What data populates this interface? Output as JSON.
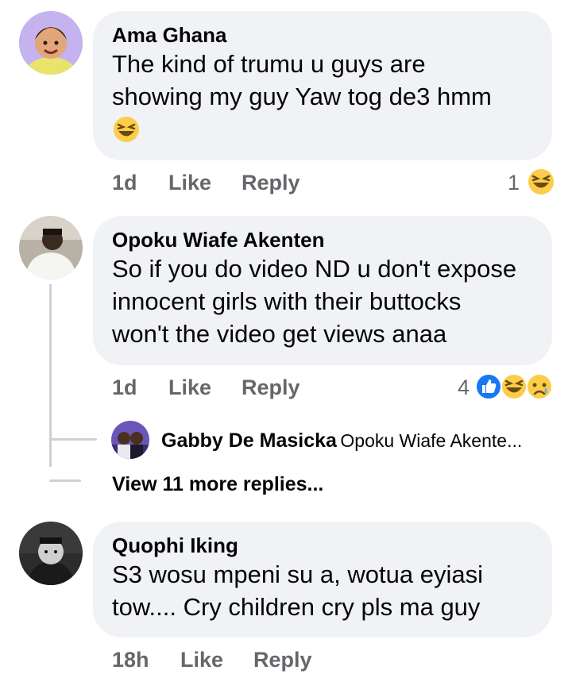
{
  "comments": [
    {
      "author": "Ama Ghana",
      "lines": [
        "The kind of trumu u guys are",
        "showing my guy Yaw tog de3 hmm"
      ],
      "time": "1d",
      "like_label": "Like",
      "reply_label": "Reply",
      "reaction_count": "1",
      "reactions": [
        "laughing-emoji"
      ]
    },
    {
      "author": "Opoku Wiafe Akenten",
      "lines": [
        "So if you do video ND u don't expose",
        "innocent girls with their buttocks",
        "won't the video get views anaa"
      ],
      "time": "1d",
      "like_label": "Like",
      "reply_label": "Reply",
      "reaction_count": "4",
      "reactions": [
        "like-emoji",
        "laughing-emoji",
        "sad-emoji"
      ],
      "reply_preview": {
        "author": "Gabby De Masicka",
        "snippet": "Opoku Wiafe Akente..."
      },
      "view_more": "View 11 more replies..."
    },
    {
      "author": "Quophi Iking",
      "lines": [
        "S3 wosu mpeni su a, wotua eyiasi",
        "tow.... Cry children cry pls ma guy"
      ],
      "time": "18h",
      "like_label": "Like",
      "reply_label": "Reply"
    }
  ],
  "colors": {
    "bubble": "#f0f2f5",
    "meta_text": "#65676b",
    "like_blue": "#1877f2",
    "emoji_yellow": "#fbcd4a",
    "thread_line": "#ced0d4"
  }
}
